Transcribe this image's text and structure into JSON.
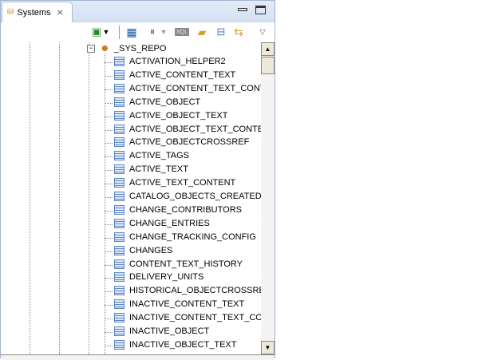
{
  "tab": {
    "title": "Systems",
    "close": "⨯"
  },
  "toolbar": {
    "sql_label": "SQL"
  },
  "tree": {
    "schema": "_SYS_REPO",
    "items": [
      "ACTIVATION_HELPER2",
      "ACTIVE_CONTENT_TEXT",
      "ACTIVE_CONTENT_TEXT_CONTEN",
      "ACTIVE_OBJECT",
      "ACTIVE_OBJECT_TEXT",
      "ACTIVE_OBJECT_TEXT_CONTENT",
      "ACTIVE_OBJECTCROSSREF",
      "ACTIVE_TAGS",
      "ACTIVE_TEXT",
      "ACTIVE_TEXT_CONTENT",
      "CATALOG_OBJECTS_CREATED_BY",
      "CHANGE_CONTRIBUTORS",
      "CHANGE_ENTRIES",
      "CHANGE_TRACKING_CONFIG",
      "CHANGES",
      "CONTENT_TEXT_HISTORY",
      "DELIVERY_UNITS",
      "HISTORICAL_OBJECTCROSSREF",
      "INACTIVE_CONTENT_TEXT",
      "INACTIVE_CONTENT_TEXT_CONT",
      "INACTIVE_OBJECT",
      "INACTIVE_OBJECT_TEXT"
    ]
  }
}
